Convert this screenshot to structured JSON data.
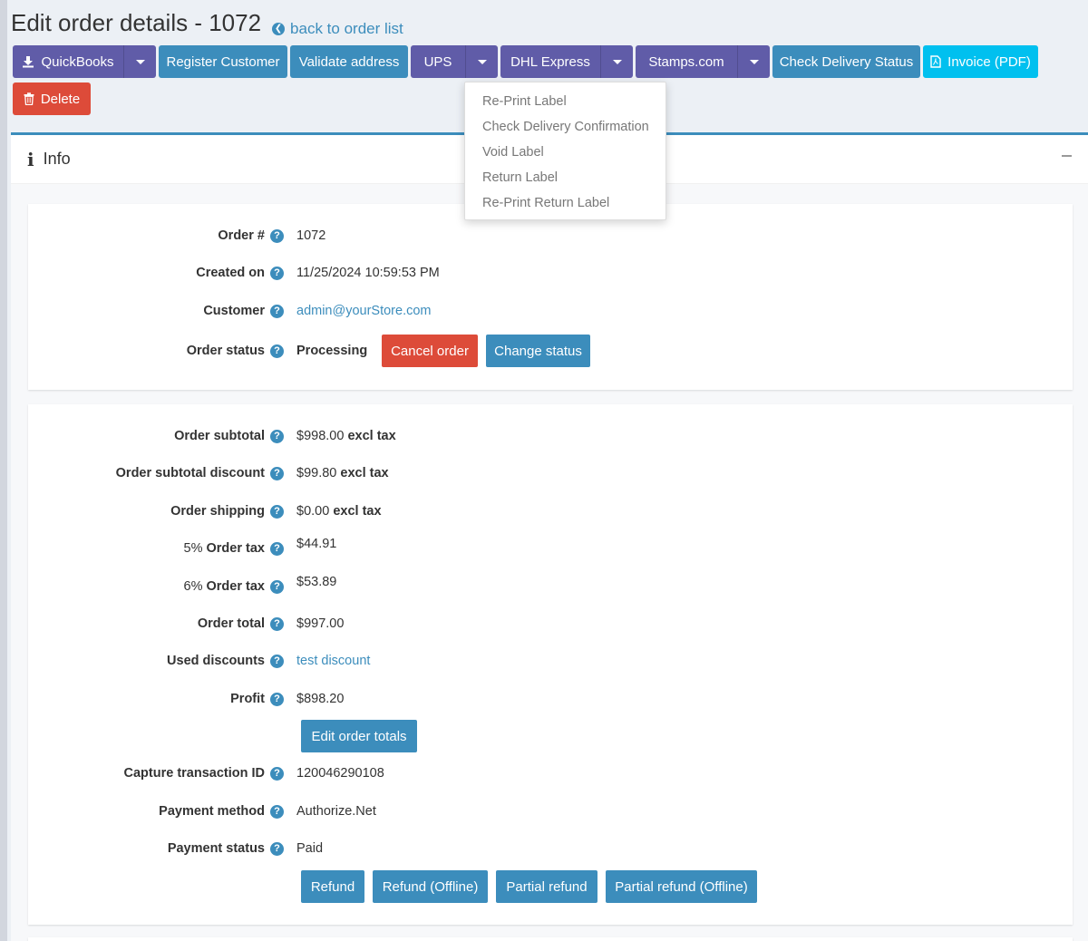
{
  "header": {
    "title": "Edit order details - 1072",
    "back_link": "back to order list"
  },
  "toolbar": {
    "quickbooks": "QuickBooks",
    "register_customer": "Register Customer",
    "validate_address": "Validate address",
    "ups": "UPS",
    "dhl_express": "DHL Express",
    "stamps": "Stamps.com",
    "check_delivery": "Check Delivery Status",
    "invoice_pdf": "Invoice (PDF)",
    "delete": "Delete"
  },
  "ups_dropdown": {
    "items": [
      "Re-Print Label",
      "Check Delivery Confirmation",
      "Void Label",
      "Return Label",
      "Re-Print Return Label"
    ]
  },
  "info_box": {
    "title": "Info"
  },
  "order": {
    "number_label": "Order #",
    "number": "1072",
    "created_label": "Created on",
    "created": "11/25/2024 10:59:53 PM",
    "customer_label": "Customer",
    "customer": "admin@yourStore.com",
    "status_label": "Order status",
    "status": "Processing",
    "cancel_order": "Cancel order",
    "change_status": "Change status"
  },
  "totals": {
    "subtotal_label": "Order subtotal",
    "subtotal": "$998.00",
    "subtotal_tax": "excl tax",
    "subtotal_discount_label": "Order subtotal discount",
    "subtotal_discount": "$99.80",
    "subtotal_discount_tax": "excl tax",
    "shipping_label": "Order shipping",
    "shipping": "$0.00",
    "shipping_tax": "excl tax",
    "tax5_rate": "5%",
    "tax5_label": "Order tax",
    "tax5": "$44.91",
    "tax6_rate": "6%",
    "tax6_label": "Order tax",
    "tax6": "$53.89",
    "total_label": "Order total",
    "total": "$997.00",
    "discounts_label": "Used discounts",
    "discounts": "test discount",
    "profit_label": "Profit",
    "profit": "$898.20",
    "edit_totals": "Edit order totals",
    "capture_label": "Capture transaction ID",
    "capture": "120046290108",
    "payment_method_label": "Payment method",
    "payment_method": "Authorize.Net",
    "payment_status_label": "Payment status",
    "payment_status": "Paid",
    "refund": "Refund",
    "refund_offline": "Refund (Offline)",
    "partial_refund": "Partial refund",
    "partial_refund_offline": "Partial refund (Offline)"
  },
  "colors": {
    "primary": "#3c8dbc",
    "purple": "#605ca8",
    "info": "#00c0ef",
    "danger": "#dd4b39"
  },
  "icons": {
    "back": "circle-arrow-left-icon",
    "download": "download-icon",
    "pdf": "file-pdf-icon",
    "trash": "trash-icon",
    "info": "info-icon",
    "help": "question-circle-icon",
    "collapse": "minus-icon"
  }
}
